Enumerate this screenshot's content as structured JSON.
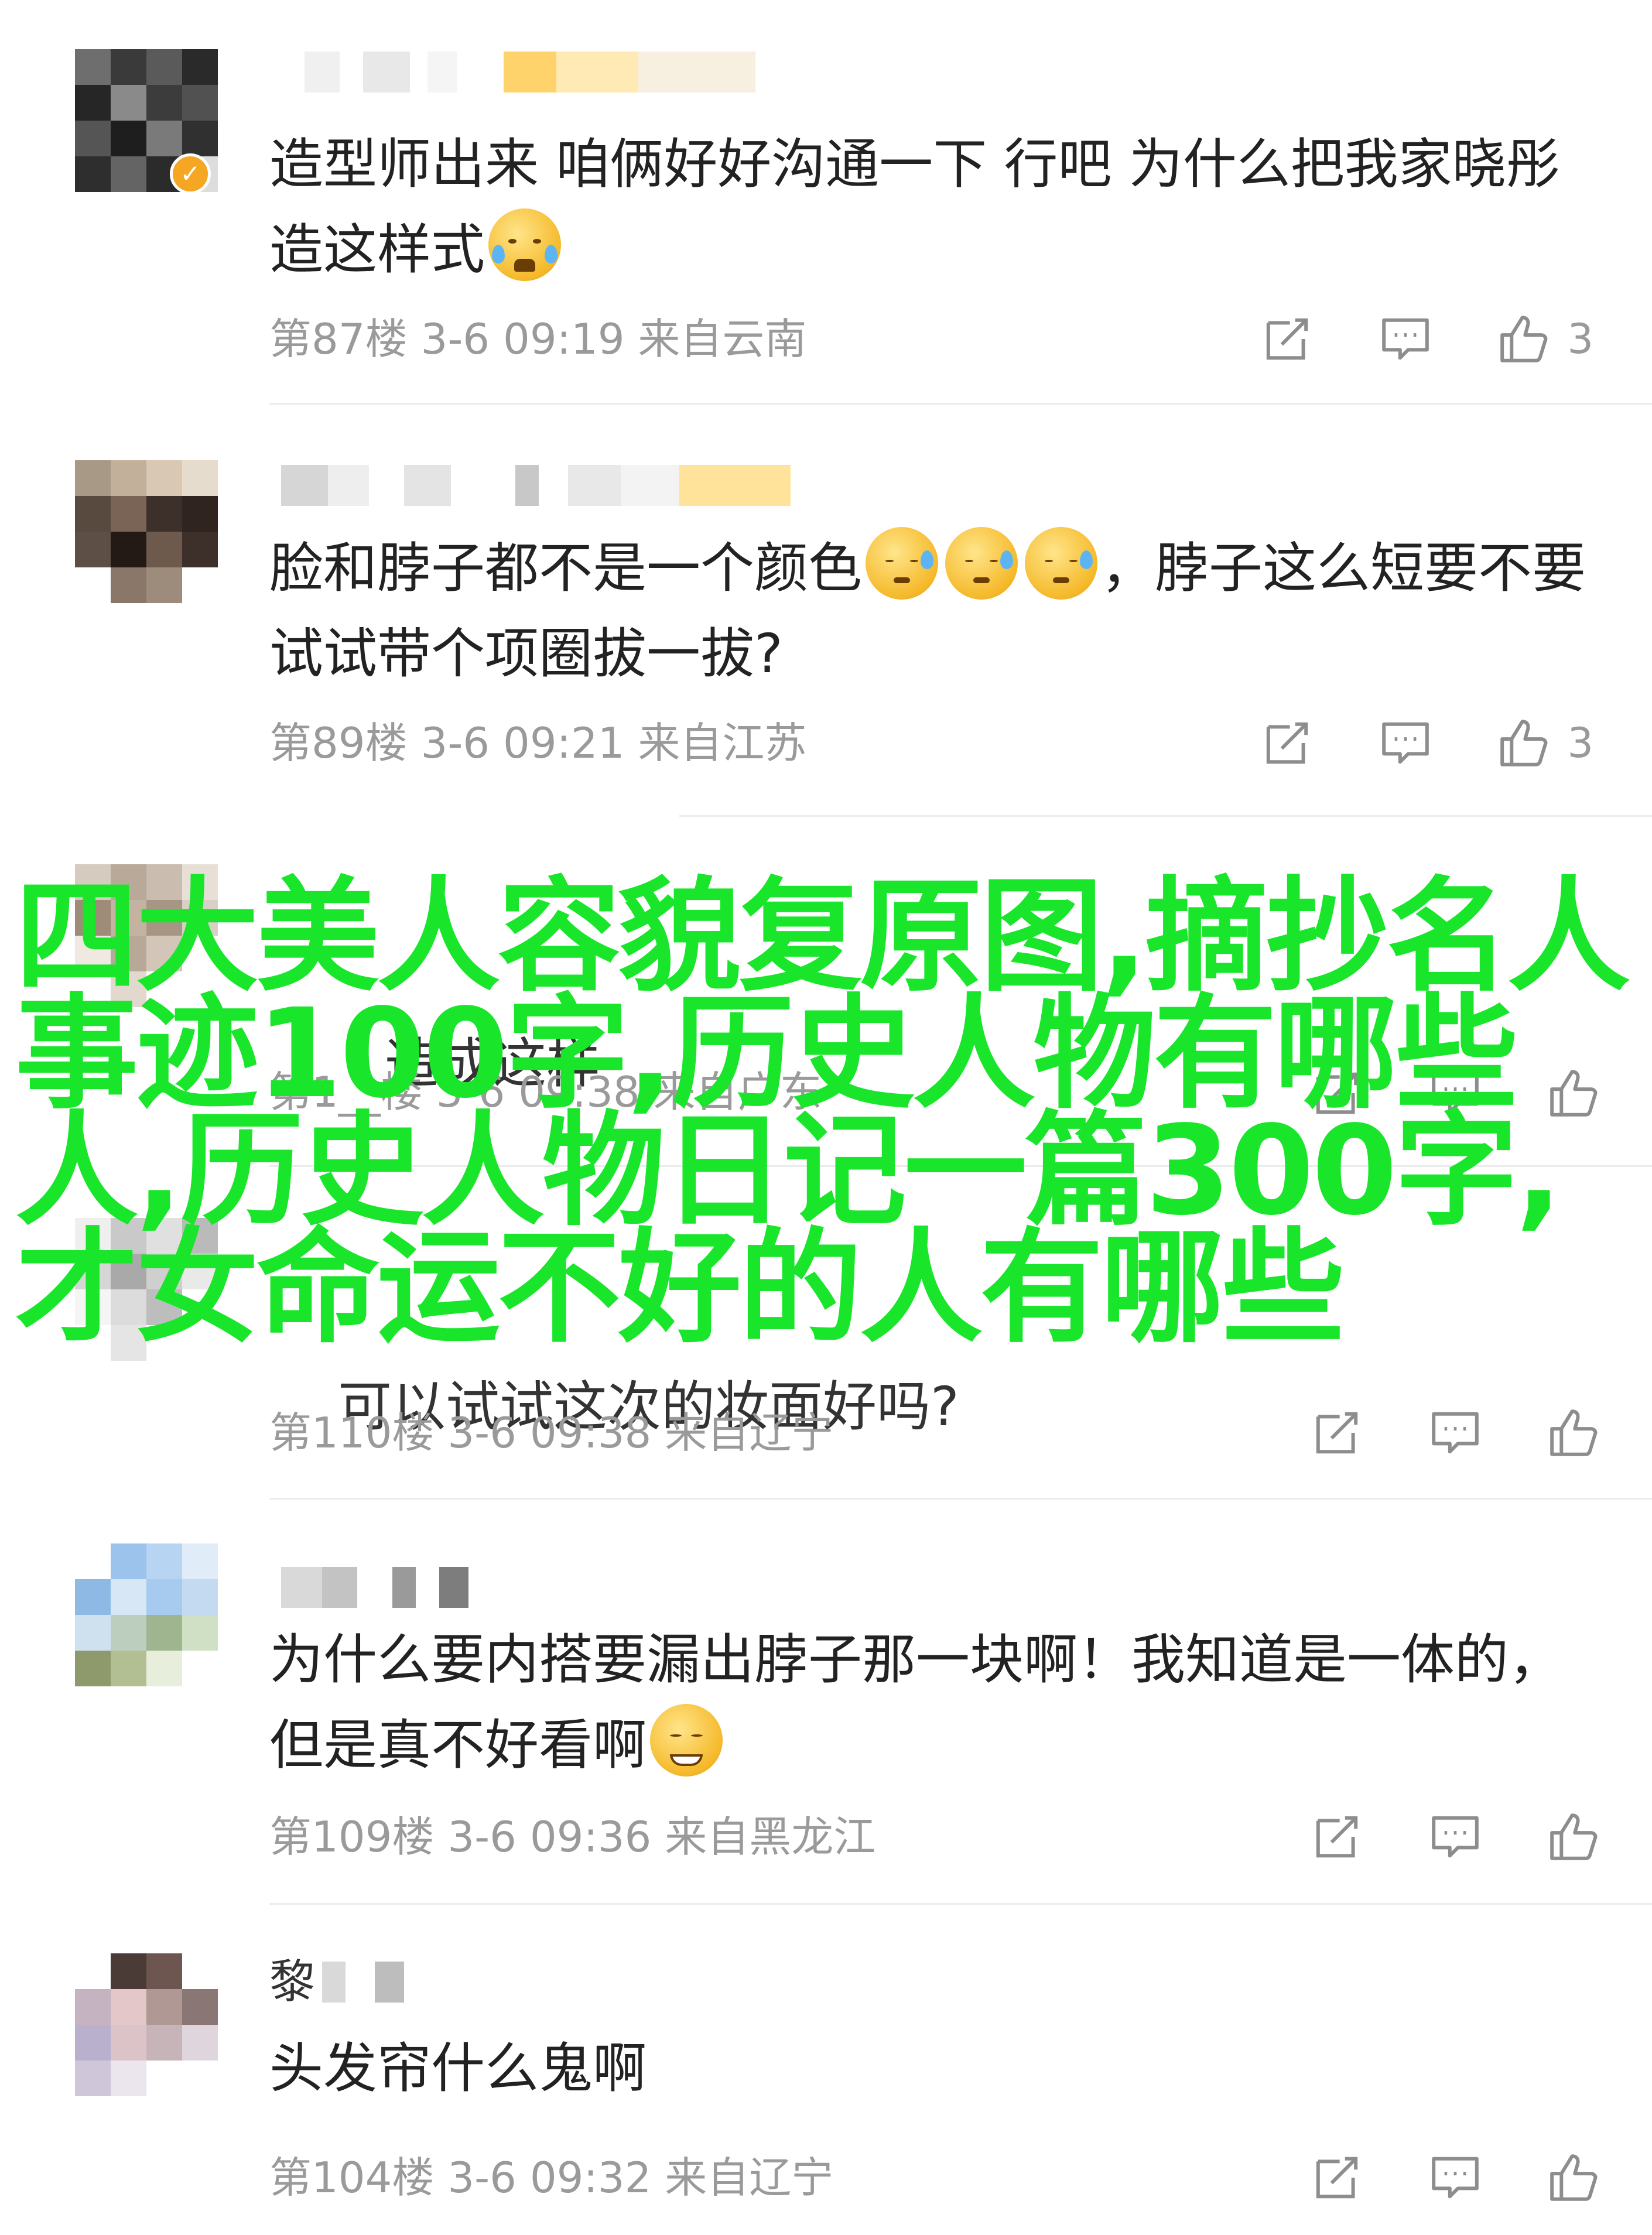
{
  "comments": [
    {
      "text": "造型师出来 咱俩好好沟通一下 行吧 为什么把我家晓彤造这样式",
      "floor": "第87楼",
      "date": "3-6",
      "time": "09:19",
      "location": "来自云南",
      "likes": "3",
      "emoji": "loudly-crying-face"
    },
    {
      "text_before": "脸和脖子都不是一个颜色",
      "text_after": "，脖子这么短要不要试试带个项圈拔一拔?",
      "floor": "第89楼",
      "date": "3-6",
      "time": "09:21",
      "location": "来自江苏",
      "likes": "3",
      "emoji": "cold-sweat-face"
    },
    {
      "partial_text": "造成这样",
      "floor": "第1__楼",
      "date": "3-6",
      "time": "09:38",
      "location": "来自广东",
      "likes": ""
    },
    {
      "partial_text": "可以试试这次的妆面好吗?",
      "floor": "第110楼",
      "date": "3-6",
      "time": "09:38",
      "location": "来自辽宁",
      "likes": ""
    },
    {
      "text": "为什么要内搭要漏出脖子那一块啊！我知道是一体的，但是真不好看啊",
      "floor": "第109楼",
      "date": "3-6",
      "time": "09:36",
      "location": "来自黑龙江",
      "likes": "",
      "emoji": "dizzy-face"
    },
    {
      "username_visible": "黎",
      "text": "头发帘什么鬼啊",
      "floor": "第104楼",
      "date": "3-6",
      "time": "09:32",
      "location": "来自辽宁",
      "likes": ""
    }
  ],
  "overlay_title": "四大美人容貌复原图,摘抄名人事迹100字,历史人物有哪些人,历史人物日记一篇300字,才女命运不好的人有哪些",
  "icons": [
    "share-icon",
    "reply-icon",
    "like-icon"
  ],
  "colors": {
    "overlay": "#19e62b",
    "meta": "#9a9a9a",
    "text": "#222222",
    "badge": "#f5a623"
  }
}
